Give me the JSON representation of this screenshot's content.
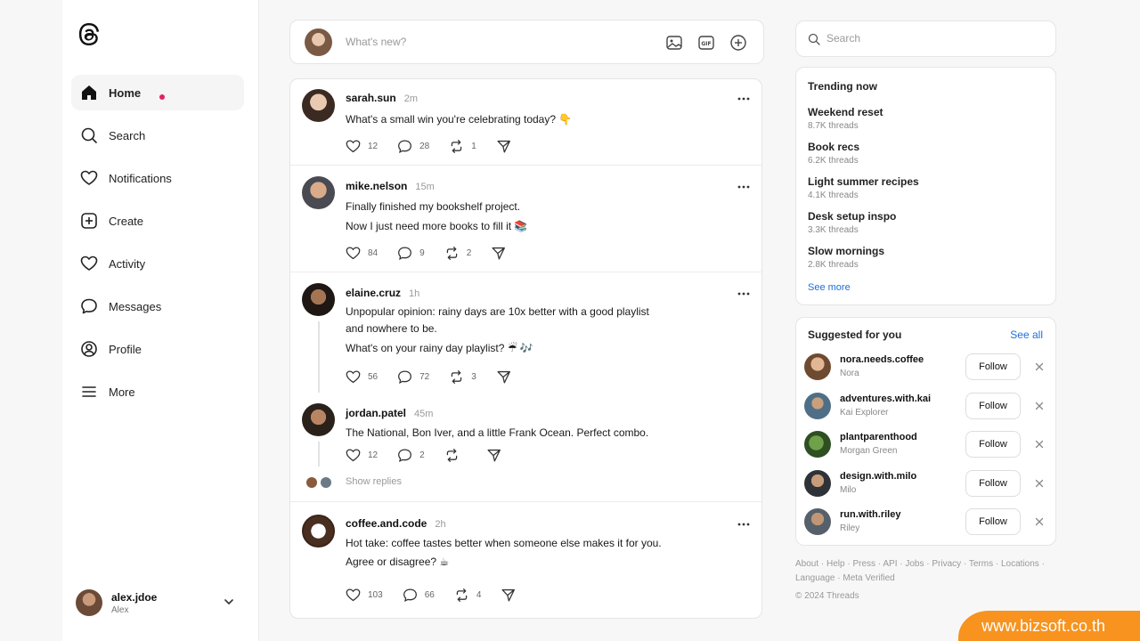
{
  "sidebar": {
    "nav": [
      {
        "label": "Home",
        "icon": "home-icon",
        "active": true
      },
      {
        "label": "Search",
        "icon": "search-icon"
      },
      {
        "label": "Notifications",
        "icon": "heart-icon"
      },
      {
        "label": "Create",
        "icon": "plus-square-icon"
      },
      {
        "label": "Activity",
        "icon": "heart-icon"
      },
      {
        "label": "Messages",
        "icon": "chat-bubble-icon"
      },
      {
        "label": "Profile",
        "icon": "user-circle-icon"
      },
      {
        "label": "More",
        "icon": "menu-icon"
      }
    ],
    "user": {
      "username": "alex.jdoe",
      "name": "Alex"
    }
  },
  "composer": {
    "placeholder": "What's new?"
  },
  "posts": [
    {
      "user": "sarah.sun",
      "time": "2m",
      "lines": [
        "What's a small win you're celebrating today? 👇"
      ],
      "likes": "12",
      "replies": "28",
      "reposts": "1"
    },
    {
      "user": "mike.nelson",
      "time": "15m",
      "lines": [
        "Finally finished my bookshelf project.",
        "Now I just need more books to fill it 📚"
      ],
      "likes": "84",
      "replies": "9",
      "reposts": "2"
    },
    {
      "user": "elaine.cruz",
      "time": "1h",
      "lines": [
        "Unpopular opinion: rainy days are 10x better with a good playlist",
        "and nowhere to be.",
        "What's on your rainy day playlist? ☔ 🎶"
      ],
      "likes": "56",
      "replies": "72",
      "reposts": "3"
    },
    {
      "user": "jordan.patel",
      "time": "45m",
      "lines": [
        "The National, Bon Iver, and a little Frank Ocean. Perfect combo."
      ],
      "likes": "12",
      "replies": "2",
      "reposts": "",
      "show_replies": "Show replies"
    },
    {
      "user": "coffee.and.code",
      "time": "2h",
      "lines": [
        "Hot take: coffee tastes better when someone else makes it for you.",
        "Agree or disagree? ☕"
      ],
      "likes": "103",
      "replies": "66",
      "reposts": "4"
    }
  ],
  "search": {
    "placeholder": "Search"
  },
  "trending": {
    "title": "Trending now",
    "items": [
      {
        "name": "Weekend reset",
        "count": "8.7K threads"
      },
      {
        "name": "Book recs",
        "count": "6.2K threads"
      },
      {
        "name": "Light summer recipes",
        "count": "4.1K threads"
      },
      {
        "name": "Desk setup inspo",
        "count": "3.3K threads"
      },
      {
        "name": "Slow mornings",
        "count": "2.8K threads"
      }
    ],
    "see_more": "See more"
  },
  "suggested": {
    "title": "Suggested for you",
    "see_all": "See all",
    "follow_label": "Follow",
    "items": [
      {
        "username": "nora.needs.coffee",
        "name": "Nora"
      },
      {
        "username": "adventures.with.kai",
        "name": "Kai Explorer"
      },
      {
        "username": "plantparenthood",
        "name": "Morgan Green"
      },
      {
        "username": "design.with.milo",
        "name": "Milo"
      },
      {
        "username": "run.with.riley",
        "name": "Riley"
      }
    ]
  },
  "footer": {
    "links": "About · Help · Press · API · Jobs · Privacy · Terms · Locations · Language · Meta Verified",
    "copyright": "© 2024 Threads"
  },
  "watermark": "www.bizsoft.co.th"
}
